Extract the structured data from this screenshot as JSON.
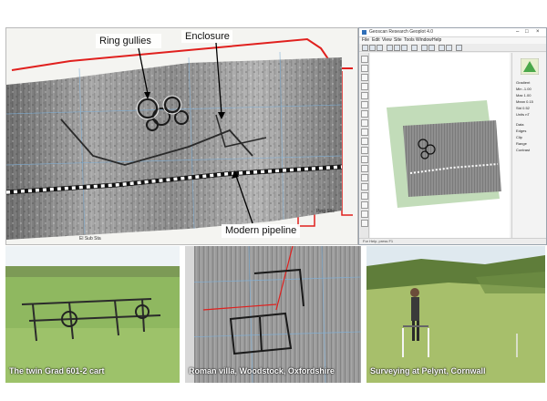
{
  "map": {
    "annotations": {
      "ring_gullies": "Ring gullies",
      "enclosure": "Enclosure",
      "modern_pipeline": "Modern pipeline"
    },
    "small_labels": {
      "ping_site": "Ping Site",
      "el_sub_sta": "El Sub Sta"
    },
    "colors": {
      "boundary": "#e0201e",
      "gridline": "#7fb0d8",
      "pipeline": "#ffffff"
    }
  },
  "software_window": {
    "title": "Geoscan Research Geoplot 4.0",
    "window_controls": [
      "–",
      "□",
      "×"
    ],
    "menu": [
      "File",
      "Edit",
      "View",
      "Site",
      "Tools",
      "Window",
      "Help"
    ],
    "right_panel": [
      "Gradient",
      "Min -1.00",
      "Max 1.00",
      "Mean 0.15",
      "Std 0.52",
      "Units nT",
      "Data",
      "Edges",
      "Clip",
      "Range",
      "Contrast"
    ],
    "status": "For Help, press F1",
    "icons": {
      "palette": "green-triangle-icon"
    }
  },
  "photos": [
    {
      "caption": "The twin Grad 601-2 cart"
    },
    {
      "caption": "Roman villa, Woodstock, Oxfordshire"
    },
    {
      "caption": "Surveying at Pelynt, Cornwall"
    }
  ]
}
